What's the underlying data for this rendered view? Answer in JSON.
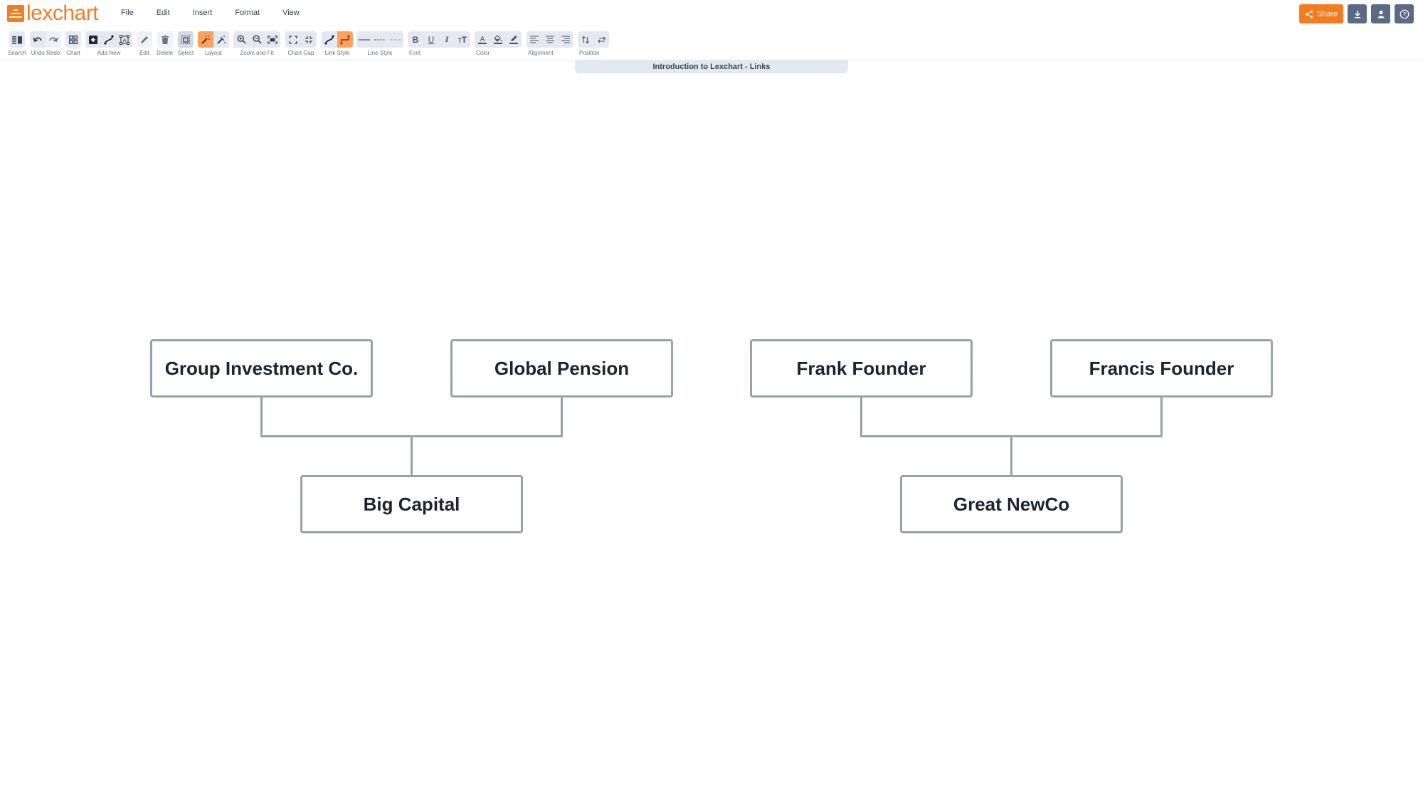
{
  "app": {
    "logo_text": "lexchart",
    "brand_color": "#f47b20",
    "menu": [
      "File",
      "Edit",
      "Insert",
      "Format",
      "View"
    ],
    "actions": {
      "share_label": "Share",
      "download_icon": "download-icon",
      "user_icon": "user-icon",
      "help_icon": "help-icon"
    }
  },
  "toolbar": {
    "groups": [
      {
        "label": "Search",
        "buttons": [
          "search-panel-icon"
        ]
      },
      {
        "label": "Undo",
        "label2": "Redo",
        "buttons": [
          "undo-icon",
          "redo-icon"
        ]
      },
      {
        "label": "Chart",
        "buttons": [
          "chart-grid-icon"
        ]
      },
      {
        "label": "Add New",
        "buttons": [
          "add-box-icon",
          "add-link-icon",
          "add-text-icon"
        ]
      },
      {
        "label": "Edit",
        "buttons": [
          "pencil-icon"
        ]
      },
      {
        "label": "Delete",
        "buttons": [
          "trash-icon"
        ]
      },
      {
        "label": "Select",
        "buttons": [
          "select-icon"
        ]
      },
      {
        "label": "Layout",
        "buttons": [
          "magic-wand-icon",
          "magic-wand-alt-icon"
        ]
      },
      {
        "label": "Zoom and Fit",
        "buttons": [
          "zoom-in-icon",
          "zoom-out-icon",
          "fit-icon"
        ]
      },
      {
        "label": "Chart Gap",
        "buttons": [
          "expand-gap-icon",
          "shrink-gap-icon"
        ]
      },
      {
        "label": "Link Style",
        "buttons": [
          "curved-link-icon",
          "elbow-link-icon"
        ]
      },
      {
        "label": "Line Style",
        "buttons": [
          "solid-line-icon",
          "dashed-line-icon",
          "dotted-line-icon"
        ]
      },
      {
        "label": "Font",
        "buttons": [
          "bold-icon",
          "underline-icon",
          "italic-icon",
          "text-size-icon"
        ]
      },
      {
        "label": "Color",
        "buttons": [
          "text-color-icon",
          "fill-color-icon",
          "line-color-icon"
        ]
      },
      {
        "label": "Alignment",
        "buttons": [
          "align-left-icon",
          "align-center-icon",
          "align-right-icon"
        ]
      },
      {
        "label": "Position",
        "buttons": [
          "swap-vertical-icon",
          "swap-horizontal-icon"
        ]
      }
    ]
  },
  "document": {
    "title": "Introduction to Lexchart - Links"
  },
  "chart": {
    "nodes": [
      {
        "id": "n1",
        "label": "Group Investment Co."
      },
      {
        "id": "n2",
        "label": "Global Pension"
      },
      {
        "id": "n3",
        "label": "Big Capital"
      },
      {
        "id": "n4",
        "label": "Frank Founder"
      },
      {
        "id": "n5",
        "label": "Francis Founder"
      },
      {
        "id": "n6",
        "label": "Great NewCo"
      }
    ],
    "links": [
      {
        "from": "n1",
        "to": "n3"
      },
      {
        "from": "n2",
        "to": "n3"
      },
      {
        "from": "n4",
        "to": "n6"
      },
      {
        "from": "n5",
        "to": "n6"
      }
    ],
    "link_color": "#9aa1ac"
  }
}
